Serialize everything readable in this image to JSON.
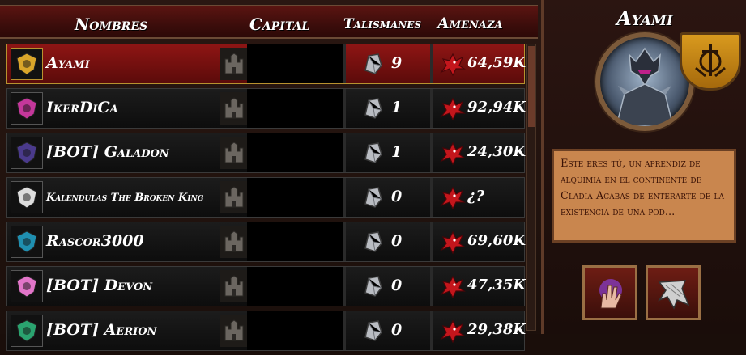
{
  "header": {
    "col_names": "Nombres",
    "col_capital": "Capital",
    "col_talismans": "Talismanes",
    "col_threat": "Amenaza"
  },
  "players": [
    {
      "name": "Ayami",
      "talismans": "9",
      "threat": "64,59K",
      "selected": true,
      "emblem_color": "#d9a52a"
    },
    {
      "name": "IkerDiCa",
      "talismans": "1",
      "threat": "92,94K",
      "selected": false,
      "emblem_color": "#c4379b"
    },
    {
      "name": "[BOT] Galadon",
      "talismans": "1",
      "threat": "24,30K",
      "selected": false,
      "emblem_color": "#4a3a8c"
    },
    {
      "name": "Kalendulas The Broken King",
      "talismans": "0",
      "threat": "¿?",
      "selected": false,
      "emblem_color": "#dddddd"
    },
    {
      "name": "Rascor3000",
      "talismans": "0",
      "threat": "69,60K",
      "selected": false,
      "emblem_color": "#1f8fb0"
    },
    {
      "name": "[BOT] Devon",
      "talismans": "0",
      "threat": "47,35K",
      "selected": false,
      "emblem_color": "#e275c9"
    },
    {
      "name": "[BOT] Aerion",
      "talismans": "0",
      "threat": "29,38K",
      "selected": false,
      "emblem_color": "#2aa36f"
    }
  ],
  "profile": {
    "title": "Ayami",
    "description": "Este eres tú, un aprendiz de alquimia en el continente de Cladia Acabas de enterarte de la existencia de una pod...",
    "action_1_icon": "magic-hand-icon",
    "action_2_icon": "cloak-icon"
  },
  "colors": {
    "accent_red": "#8e1514",
    "gold": "#d99a1e",
    "parchment": "#c9864e"
  }
}
